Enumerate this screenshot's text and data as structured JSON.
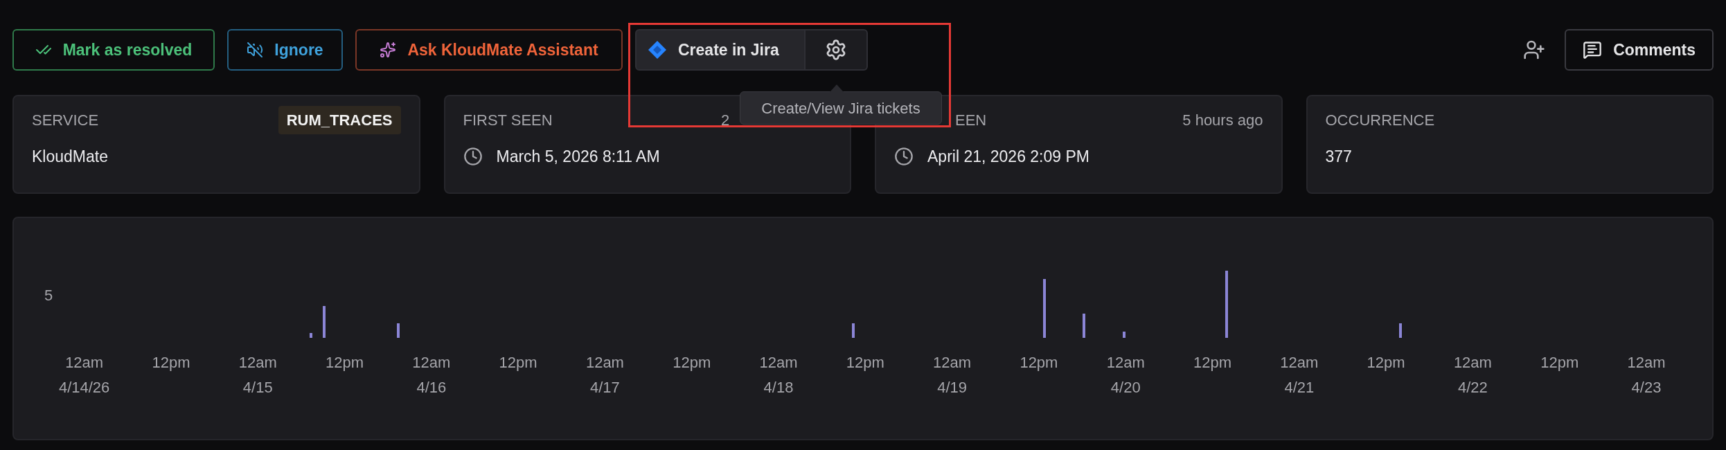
{
  "actions": [
    {
      "kind": "resolve",
      "label": "Mark as resolved"
    },
    {
      "kind": "ignore",
      "label": "Ignore"
    },
    {
      "kind": "assistant",
      "label": "Ask KloudMate Assistant"
    }
  ],
  "jira": {
    "label": "Create in Jira",
    "tooltip": "Create/View Jira tickets"
  },
  "comments": {
    "label": "Comments"
  },
  "cards": [
    {
      "kind": "text",
      "title": "SERVICE",
      "badge": "RUM_TRACES",
      "value": "KloudMate"
    },
    {
      "kind": "time",
      "title": "FIRST SEEN",
      "aside": "2",
      "value": "March 5, 2026 8:11 AM"
    },
    {
      "kind": "time",
      "title": "EEN",
      "aside": "5 hours ago",
      "value": "April 21, 2026 2:09 PM"
    },
    {
      "kind": "text",
      "title": "OCCURRENCE",
      "value": "377"
    }
  ],
  "chart": {
    "y_tick": "5",
    "x_labels": [
      {
        "time": "12am",
        "date": "4/14/26"
      },
      {
        "time": "12pm"
      },
      {
        "time": "12am",
        "date": "4/15"
      },
      {
        "time": "12pm"
      },
      {
        "time": "12am",
        "date": "4/16"
      },
      {
        "time": "12pm"
      },
      {
        "time": "12am",
        "date": "4/17"
      },
      {
        "time": "12pm"
      },
      {
        "time": "12am",
        "date": "4/18"
      },
      {
        "time": "12pm"
      },
      {
        "time": "12am",
        "date": "4/19"
      },
      {
        "time": "12pm"
      },
      {
        "time": "12am",
        "date": "4/20"
      },
      {
        "time": "12pm"
      },
      {
        "time": "12am",
        "date": "4/21"
      },
      {
        "time": "12pm"
      },
      {
        "time": "12am",
        "date": "4/22"
      },
      {
        "time": "12pm"
      },
      {
        "time": "12am",
        "date": "4/23"
      }
    ]
  }
}
